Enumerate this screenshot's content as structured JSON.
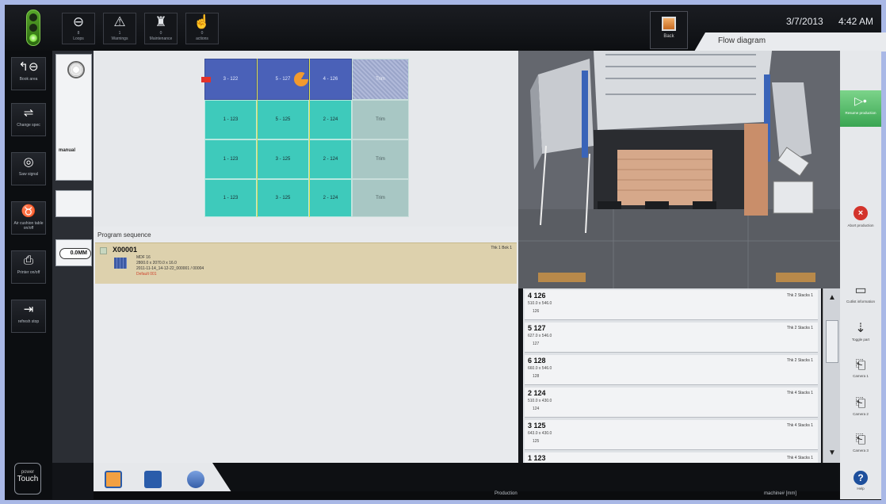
{
  "topbar": {
    "buttons": [
      {
        "label": "Loops",
        "count": "8",
        "icon": "minus-circle-icon"
      },
      {
        "label": "Warnings",
        "count": "1",
        "icon": "warning-icon"
      },
      {
        "label": "Maintenance",
        "count": "0",
        "icon": "oilcan-icon"
      },
      {
        "label": "actions",
        "count": "0",
        "icon": "hand-icon"
      }
    ],
    "back_label": "Back",
    "date": "3/7/2013",
    "time": "4:42 AM",
    "tab_label": "Flow diagram"
  },
  "leftbar": {
    "buttons": [
      {
        "label": "Book area",
        "icon": "book-area-icon"
      },
      {
        "label": "Change spec",
        "icon": "change-icon"
      },
      {
        "label": "Saw signal",
        "icon": "saw-icon"
      },
      {
        "label": "Air cushion table on/off",
        "icon": "air-cushion-icon"
      },
      {
        "label": "Printer on/off",
        "icon": "printer-icon"
      },
      {
        "label": "refresh stop",
        "icon": "refresh-icon"
      }
    ],
    "logo_top": "power",
    "logo_bottom": "Touch"
  },
  "narrow": {
    "mode_label": "manual",
    "gauge_value": "0.0MM"
  },
  "pattern": {
    "rows": [
      [
        "3 - 122",
        "5 - 127",
        "4 - 126",
        "Trim"
      ],
      [
        "1 - 123",
        "5 - 125",
        "2 - 124",
        "Trim"
      ],
      [
        "1 - 123",
        "3 - 125",
        "2 - 124",
        "Trim"
      ],
      [
        "1 - 123",
        "3 - 125",
        "2 - 124",
        "Trim"
      ]
    ]
  },
  "program": {
    "title": "Program sequence",
    "item_name": "X00001",
    "line1": "MDF 16",
    "line2": "2800.0 x 2070.0 x 16.0",
    "line3": "2011-11-14_14-12-22_000001 / 00004",
    "line4": "Default 001",
    "tb": "Thk 1 Bok 1"
  },
  "parts": [
    {
      "id": "4 126",
      "dim": "510.0 x 546.0",
      "sub": "126",
      "cnt": "Thk 2 Stacks 1"
    },
    {
      "id": "5 127",
      "dim": "627.0 x 546.0",
      "sub": "127",
      "cnt": "Thk 2 Stacks 1"
    },
    {
      "id": "6 128",
      "dim": "660.0 x 546.0",
      "sub": "128",
      "cnt": "Thk 2 Stacks 1"
    },
    {
      "id": "2 124",
      "dim": "510.0 x 430.0",
      "sub": "124",
      "cnt": "Thk 4 Stacks 1"
    },
    {
      "id": "3 125",
      "dim": "643.0 x 430.0",
      "sub": "125",
      "cnt": "Thk 4 Stacks 1"
    },
    {
      "id": "1 123",
      "dim": "",
      "sub": "",
      "cnt": "Thk 4 Stacks 1"
    }
  ],
  "rightbar": {
    "continue_label": "Resume production",
    "abort_label": "Abort production",
    "buttons": [
      {
        "label": "Cutlist information",
        "icon": "window-icon"
      },
      {
        "label": "Toggle part",
        "icon": "toggle-icon"
      },
      {
        "label": "Camera 1",
        "icon": "camera-icon"
      },
      {
        "label": "Camera 2",
        "icon": "camera-icon"
      },
      {
        "label": "Camera 3",
        "icon": "camera-icon"
      }
    ],
    "help_label": "Help"
  },
  "status": {
    "mode": "Production",
    "unit": "machine# [mm]"
  },
  "colors": {
    "teal": "#3ecabb",
    "blue": "#4a61b8",
    "trim": "#a8c7c4",
    "frame": "#a9b8e6"
  }
}
